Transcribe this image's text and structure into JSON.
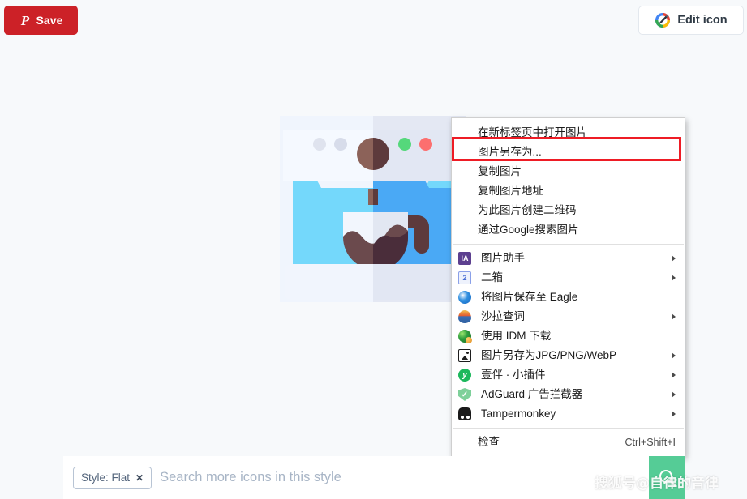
{
  "toolbar": {
    "save_label": "Save",
    "save_icon": "pinterest-p-icon",
    "save_color": "#cc2127",
    "edit_label": "Edit icon",
    "edit_icon": "colored-pencil-icon"
  },
  "artwork": {
    "name": "coffee-machine-flat-icon",
    "colors": {
      "body_light": "#f0f5fd",
      "body_shade": "#dfe3ee",
      "panel_light": "#74d8fb",
      "panel_shade": "#4aa9f5",
      "cup_light": "#f2f6fd",
      "cup_shade": "#e2e7f2",
      "coffee_light": "#6b4a4d",
      "coffee_dark": "#4a2d3a",
      "knob_light": "#8c6259",
      "knob_dark": "#5d3a3c",
      "dot_green": "#55d87b",
      "dot_red": "#fc6f6f",
      "dot_grey": "#dfe3ee"
    }
  },
  "context_menu": {
    "groups": [
      {
        "items": [
          {
            "label": "在新标签页中打开图片",
            "icon": null,
            "submenu": false,
            "shortcut": null,
            "highlighted": false
          },
          {
            "label": "图片另存为...",
            "icon": null,
            "submenu": false,
            "shortcut": null,
            "highlighted": true
          },
          {
            "label": "复制图片",
            "icon": null,
            "submenu": false,
            "shortcut": null,
            "highlighted": false
          },
          {
            "label": "复制图片地址",
            "icon": null,
            "submenu": false,
            "shortcut": null,
            "highlighted": false
          },
          {
            "label": "为此图片创建二维码",
            "icon": null,
            "submenu": false,
            "shortcut": null,
            "highlighted": false
          },
          {
            "label": "通过Google搜索图片",
            "icon": null,
            "submenu": false,
            "shortcut": null,
            "highlighted": false
          }
        ]
      },
      {
        "items": [
          {
            "label": "图片助手",
            "icon": "image-assistant-icon",
            "submenu": true,
            "shortcut": null,
            "highlighted": false
          },
          {
            "label": "二箱",
            "icon": "erxiang-icon",
            "submenu": true,
            "shortcut": null,
            "highlighted": false
          },
          {
            "label": "将图片保存至 Eagle",
            "icon": "eagle-icon",
            "submenu": false,
            "shortcut": null,
            "highlighted": false
          },
          {
            "label": "沙拉查词",
            "icon": "saladict-icon",
            "submenu": true,
            "shortcut": null,
            "highlighted": false
          },
          {
            "label": "使用 IDM 下载",
            "icon": "idm-icon",
            "submenu": false,
            "shortcut": null,
            "highlighted": false
          },
          {
            "label": "图片另存为JPG/PNG/WebP",
            "icon": "image-save-format-icon",
            "submenu": true,
            "shortcut": null,
            "highlighted": false
          },
          {
            "label": "壹伴 · 小插件",
            "icon": "yiban-icon",
            "submenu": true,
            "shortcut": null,
            "highlighted": false
          },
          {
            "label": "AdGuard 广告拦截器",
            "icon": "adguard-shield-icon",
            "submenu": true,
            "shortcut": null,
            "highlighted": false
          },
          {
            "label": "Tampermonkey",
            "icon": "tampermonkey-icon",
            "submenu": true,
            "shortcut": null,
            "highlighted": false
          }
        ]
      },
      {
        "items": [
          {
            "label": "检查",
            "icon": null,
            "submenu": false,
            "shortcut": "Ctrl+Shift+I",
            "highlighted": false
          }
        ]
      }
    ],
    "highlight_color": "#ee1c25"
  },
  "search": {
    "chip_label": "Style: Flat",
    "chip_close_icon": "close-icon",
    "placeholder": "Search more icons in this style",
    "value": "",
    "go_icon": "search-icon",
    "go_color": "#55cc96"
  },
  "watermark": {
    "text": "搜狐号@自律的音律"
  }
}
